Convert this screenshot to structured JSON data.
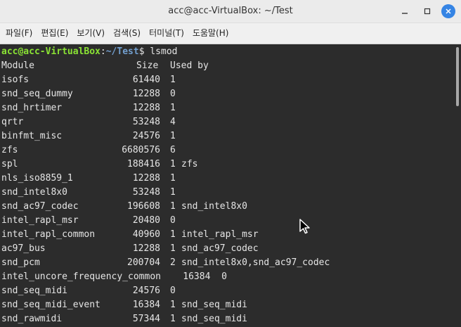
{
  "window": {
    "title": "acc@acc-VirtualBox: ~/Test"
  },
  "menu": [
    {
      "label": "파일(F)"
    },
    {
      "label": "편집(E)"
    },
    {
      "label": "보기(V)"
    },
    {
      "label": "검색(S)"
    },
    {
      "label": "터미널(T)"
    },
    {
      "label": "도움말(H)"
    }
  ],
  "prompt": {
    "user_host": "acc@acc-VirtualBox",
    "sep": ":",
    "path": "~/Test",
    "symbol": "$ ",
    "command": "lsmod"
  },
  "header": {
    "module": "Module",
    "size": "Size",
    "used": "Used by"
  },
  "modules": [
    {
      "name": "isofs",
      "size": "61440",
      "used": "1",
      "by": ""
    },
    {
      "name": "snd_seq_dummy",
      "size": "12288",
      "used": "0",
      "by": ""
    },
    {
      "name": "snd_hrtimer",
      "size": "12288",
      "used": "1",
      "by": ""
    },
    {
      "name": "qrtr",
      "size": "53248",
      "used": "4",
      "by": ""
    },
    {
      "name": "binfmt_misc",
      "size": "24576",
      "used": "1",
      "by": ""
    },
    {
      "name": "zfs",
      "size": "6680576",
      "used": "6",
      "by": ""
    },
    {
      "name": "spl",
      "size": "188416",
      "used": "1",
      "by": "zfs"
    },
    {
      "name": "nls_iso8859_1",
      "size": "12288",
      "used": "1",
      "by": ""
    },
    {
      "name": "snd_intel8x0",
      "size": "53248",
      "used": "1",
      "by": ""
    },
    {
      "name": "snd_ac97_codec",
      "size": "196608",
      "used": "1",
      "by": "snd_intel8x0"
    },
    {
      "name": "intel_rapl_msr",
      "size": "20480",
      "used": "0",
      "by": ""
    },
    {
      "name": "intel_rapl_common",
      "size": "40960",
      "used": "1",
      "by": "intel_rapl_msr"
    },
    {
      "name": "ac97_bus",
      "size": "12288",
      "used": "1",
      "by": "snd_ac97_codec"
    },
    {
      "name": "snd_pcm",
      "size": "200704",
      "used": "2",
      "by": "snd_intel8x0,snd_ac97_codec"
    },
    {
      "name": "snd_seq_midi",
      "size": "24576",
      "used": "0",
      "by": ""
    },
    {
      "name": "snd_seq_midi_event",
      "size": "16384",
      "used": "1",
      "by": "snd_seq_midi"
    },
    {
      "name": "snd_rawmidi",
      "size": "57344",
      "used": "1",
      "by": "snd_seq_midi"
    }
  ],
  "overflow_line": "intel_uncore_frequency_common    16384  0",
  "colors": {
    "user": "#8ae234",
    "path": "#729fcf",
    "text": "#e6e6e6",
    "bg": "#2c2c2c",
    "close_button": "#3584e4"
  },
  "icons": [
    "minimize-icon",
    "maximize-icon",
    "close-icon",
    "mouse-cursor-icon"
  ]
}
